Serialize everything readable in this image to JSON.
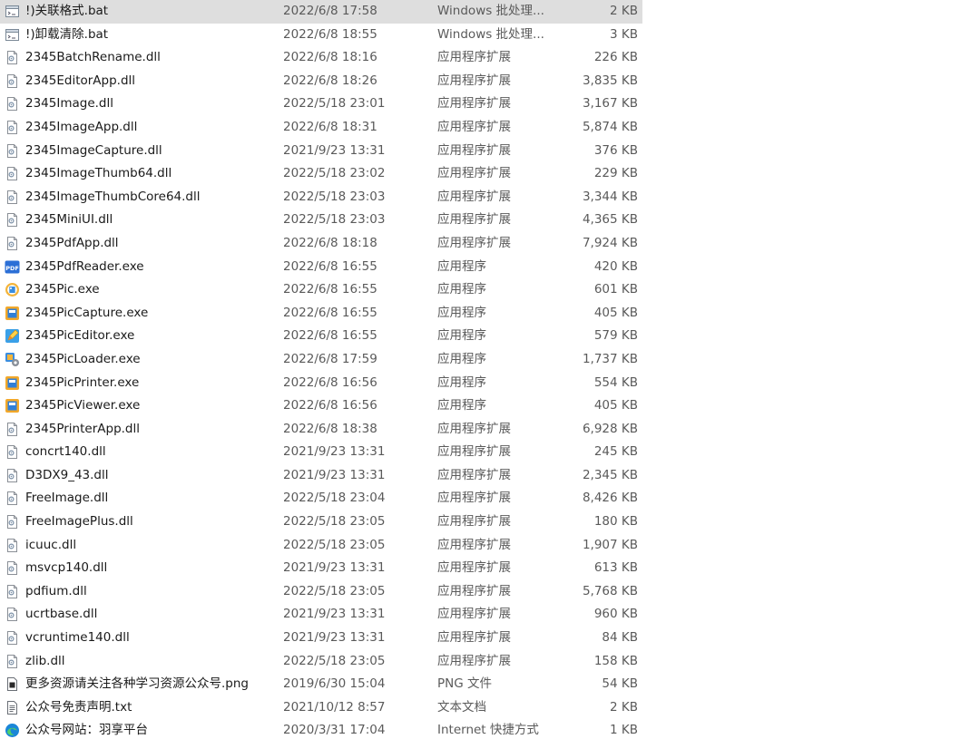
{
  "files": [
    {
      "name": "!)关联格式.bat",
      "date": "2022/6/8 17:58",
      "type": "Windows 批处理...",
      "size": "2 KB",
      "icon": "batch-file-icon",
      "selected": true
    },
    {
      "name": "!)卸载清除.bat",
      "date": "2022/6/8 18:55",
      "type": "Windows 批处理...",
      "size": "3 KB",
      "icon": "batch-file-icon"
    },
    {
      "name": "2345BatchRename.dll",
      "date": "2022/6/8 18:16",
      "type": "应用程序扩展",
      "size": "226 KB",
      "icon": "dll-file-icon"
    },
    {
      "name": "2345EditorApp.dll",
      "date": "2022/6/8 18:26",
      "type": "应用程序扩展",
      "size": "3,835 KB",
      "icon": "dll-file-icon"
    },
    {
      "name": "2345Image.dll",
      "date": "2022/5/18 23:01",
      "type": "应用程序扩展",
      "size": "3,167 KB",
      "icon": "dll-file-icon"
    },
    {
      "name": "2345ImageApp.dll",
      "date": "2022/6/8 18:31",
      "type": "应用程序扩展",
      "size": "5,874 KB",
      "icon": "dll-file-icon"
    },
    {
      "name": "2345ImageCapture.dll",
      "date": "2021/9/23 13:31",
      "type": "应用程序扩展",
      "size": "376 KB",
      "icon": "dll-file-icon"
    },
    {
      "name": "2345ImageThumb64.dll",
      "date": "2022/5/18 23:02",
      "type": "应用程序扩展",
      "size": "229 KB",
      "icon": "dll-file-icon"
    },
    {
      "name": "2345ImageThumbCore64.dll",
      "date": "2022/5/18 23:03",
      "type": "应用程序扩展",
      "size": "3,344 KB",
      "icon": "dll-file-icon"
    },
    {
      "name": "2345MiniUI.dll",
      "date": "2022/5/18 23:03",
      "type": "应用程序扩展",
      "size": "4,365 KB",
      "icon": "dll-file-icon"
    },
    {
      "name": "2345PdfApp.dll",
      "date": "2022/6/8 18:18",
      "type": "应用程序扩展",
      "size": "7,924 KB",
      "icon": "dll-file-icon"
    },
    {
      "name": "2345PdfReader.exe",
      "date": "2022/6/8 16:55",
      "type": "应用程序",
      "size": "420 KB",
      "icon": "pdf-app-icon"
    },
    {
      "name": "2345Pic.exe",
      "date": "2022/6/8 16:55",
      "type": "应用程序",
      "size": "601 KB",
      "icon": "pic-app-icon"
    },
    {
      "name": "2345PicCapture.exe",
      "date": "2022/6/8 16:55",
      "type": "应用程序",
      "size": "405 KB",
      "icon": "pic-capture-icon"
    },
    {
      "name": "2345PicEditor.exe",
      "date": "2022/6/8 16:55",
      "type": "应用程序",
      "size": "579 KB",
      "icon": "pic-editor-icon"
    },
    {
      "name": "2345PicLoader.exe",
      "date": "2022/6/8 17:59",
      "type": "应用程序",
      "size": "1,737 KB",
      "icon": "pic-loader-icon"
    },
    {
      "name": "2345PicPrinter.exe",
      "date": "2022/6/8 16:56",
      "type": "应用程序",
      "size": "554 KB",
      "icon": "pic-printer-icon"
    },
    {
      "name": "2345PicViewer.exe",
      "date": "2022/6/8 16:56",
      "type": "应用程序",
      "size": "405 KB",
      "icon": "pic-viewer-icon"
    },
    {
      "name": "2345PrinterApp.dll",
      "date": "2022/6/8 18:38",
      "type": "应用程序扩展",
      "size": "6,928 KB",
      "icon": "dll-file-icon"
    },
    {
      "name": "concrt140.dll",
      "date": "2021/9/23 13:31",
      "type": "应用程序扩展",
      "size": "245 KB",
      "icon": "dll-file-icon"
    },
    {
      "name": "D3DX9_43.dll",
      "date": "2021/9/23 13:31",
      "type": "应用程序扩展",
      "size": "2,345 KB",
      "icon": "dll-file-icon"
    },
    {
      "name": "FreeImage.dll",
      "date": "2022/5/18 23:04",
      "type": "应用程序扩展",
      "size": "8,426 KB",
      "icon": "dll-file-icon"
    },
    {
      "name": "FreeImagePlus.dll",
      "date": "2022/5/18 23:05",
      "type": "应用程序扩展",
      "size": "180 KB",
      "icon": "dll-file-icon"
    },
    {
      "name": "icuuc.dll",
      "date": "2022/5/18 23:05",
      "type": "应用程序扩展",
      "size": "1,907 KB",
      "icon": "dll-file-icon"
    },
    {
      "name": "msvcp140.dll",
      "date": "2021/9/23 13:31",
      "type": "应用程序扩展",
      "size": "613 KB",
      "icon": "dll-file-icon"
    },
    {
      "name": "pdfium.dll",
      "date": "2022/5/18 23:05",
      "type": "应用程序扩展",
      "size": "5,768 KB",
      "icon": "dll-file-icon"
    },
    {
      "name": "ucrtbase.dll",
      "date": "2021/9/23 13:31",
      "type": "应用程序扩展",
      "size": "960 KB",
      "icon": "dll-file-icon"
    },
    {
      "name": "vcruntime140.dll",
      "date": "2021/9/23 13:31",
      "type": "应用程序扩展",
      "size": "84 KB",
      "icon": "dll-file-icon"
    },
    {
      "name": "zlib.dll",
      "date": "2022/5/18 23:05",
      "type": "应用程序扩展",
      "size": "158 KB",
      "icon": "dll-file-icon"
    },
    {
      "name": "更多资源请关注各种学习资源公众号.png",
      "date": "2019/6/30 15:04",
      "type": "PNG 文件",
      "size": "54 KB",
      "icon": "png-file-icon"
    },
    {
      "name": "公众号免责声明.txt",
      "date": "2021/10/12 8:57",
      "type": "文本文档",
      "size": "2 KB",
      "icon": "text-file-icon"
    },
    {
      "name": "公众号网站：羽享平台",
      "date": "2020/3/31 17:04",
      "type": "Internet 快捷方式",
      "size": "1 KB",
      "icon": "edge-shortcut-icon"
    }
  ]
}
